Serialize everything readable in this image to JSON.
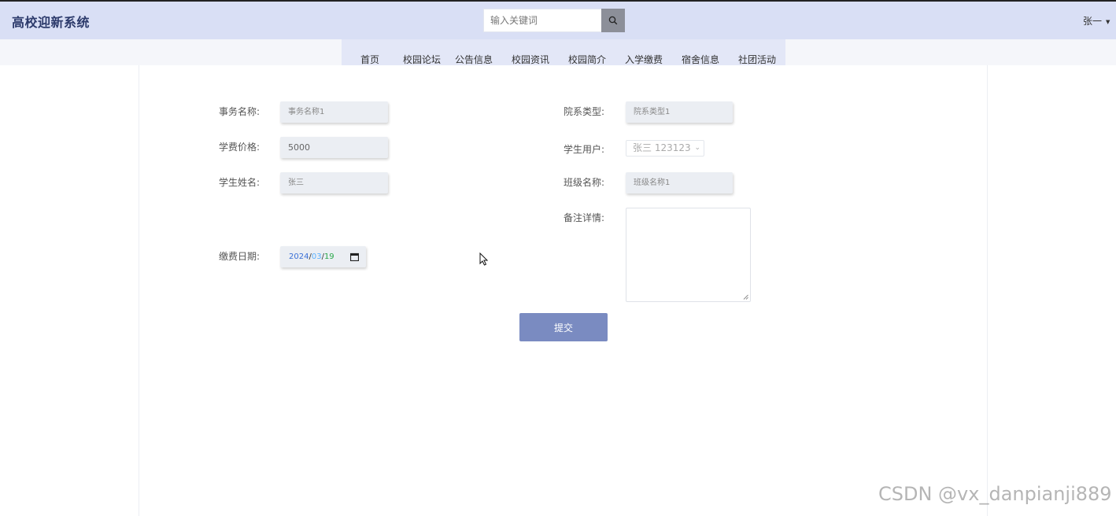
{
  "header": {
    "brand": "高校迎新系统",
    "search_placeholder": "输入关键词",
    "user": "张一"
  },
  "nav": [
    "首页",
    "校园论坛",
    "公告信息",
    "校园资讯",
    "校园简介",
    "入学缴费",
    "宿舍信息",
    "社团活动"
  ],
  "form": {
    "affair_name_label": "事务名称:",
    "affair_name_value": "事务名称1",
    "dept_type_label": "院系类型:",
    "dept_type_value": "院系类型1",
    "tuition_label": "学费价格:",
    "tuition_value": "5000",
    "student_user_label": "学生用户:",
    "student_user_value": "张三 123123",
    "student_name_label": "学生姓名:",
    "student_name_value": "张三",
    "class_name_label": "班级名称:",
    "class_name_value": "班级名称1",
    "remarks_label": "备注详情:",
    "pay_date_label": "缴费日期:",
    "pay_date_year": "2024",
    "pay_date_month": "03",
    "pay_date_day": "19",
    "submit_label": "提交"
  },
  "watermark": "CSDN @vx_danpianji889",
  "colors": {
    "header_bg": "#d9dff5",
    "nav_bg": "#e3e7f7",
    "submit_bg": "#7a8bc1",
    "search_btn_bg": "#8c8f99"
  },
  "icons": {
    "search": "search-icon",
    "user_caret": "caret-down-icon",
    "select_chevron": "chevron-down-icon",
    "calendar": "calendar-icon",
    "resize": "resize-grip-icon",
    "cursor": "mouse-pointer-icon"
  }
}
